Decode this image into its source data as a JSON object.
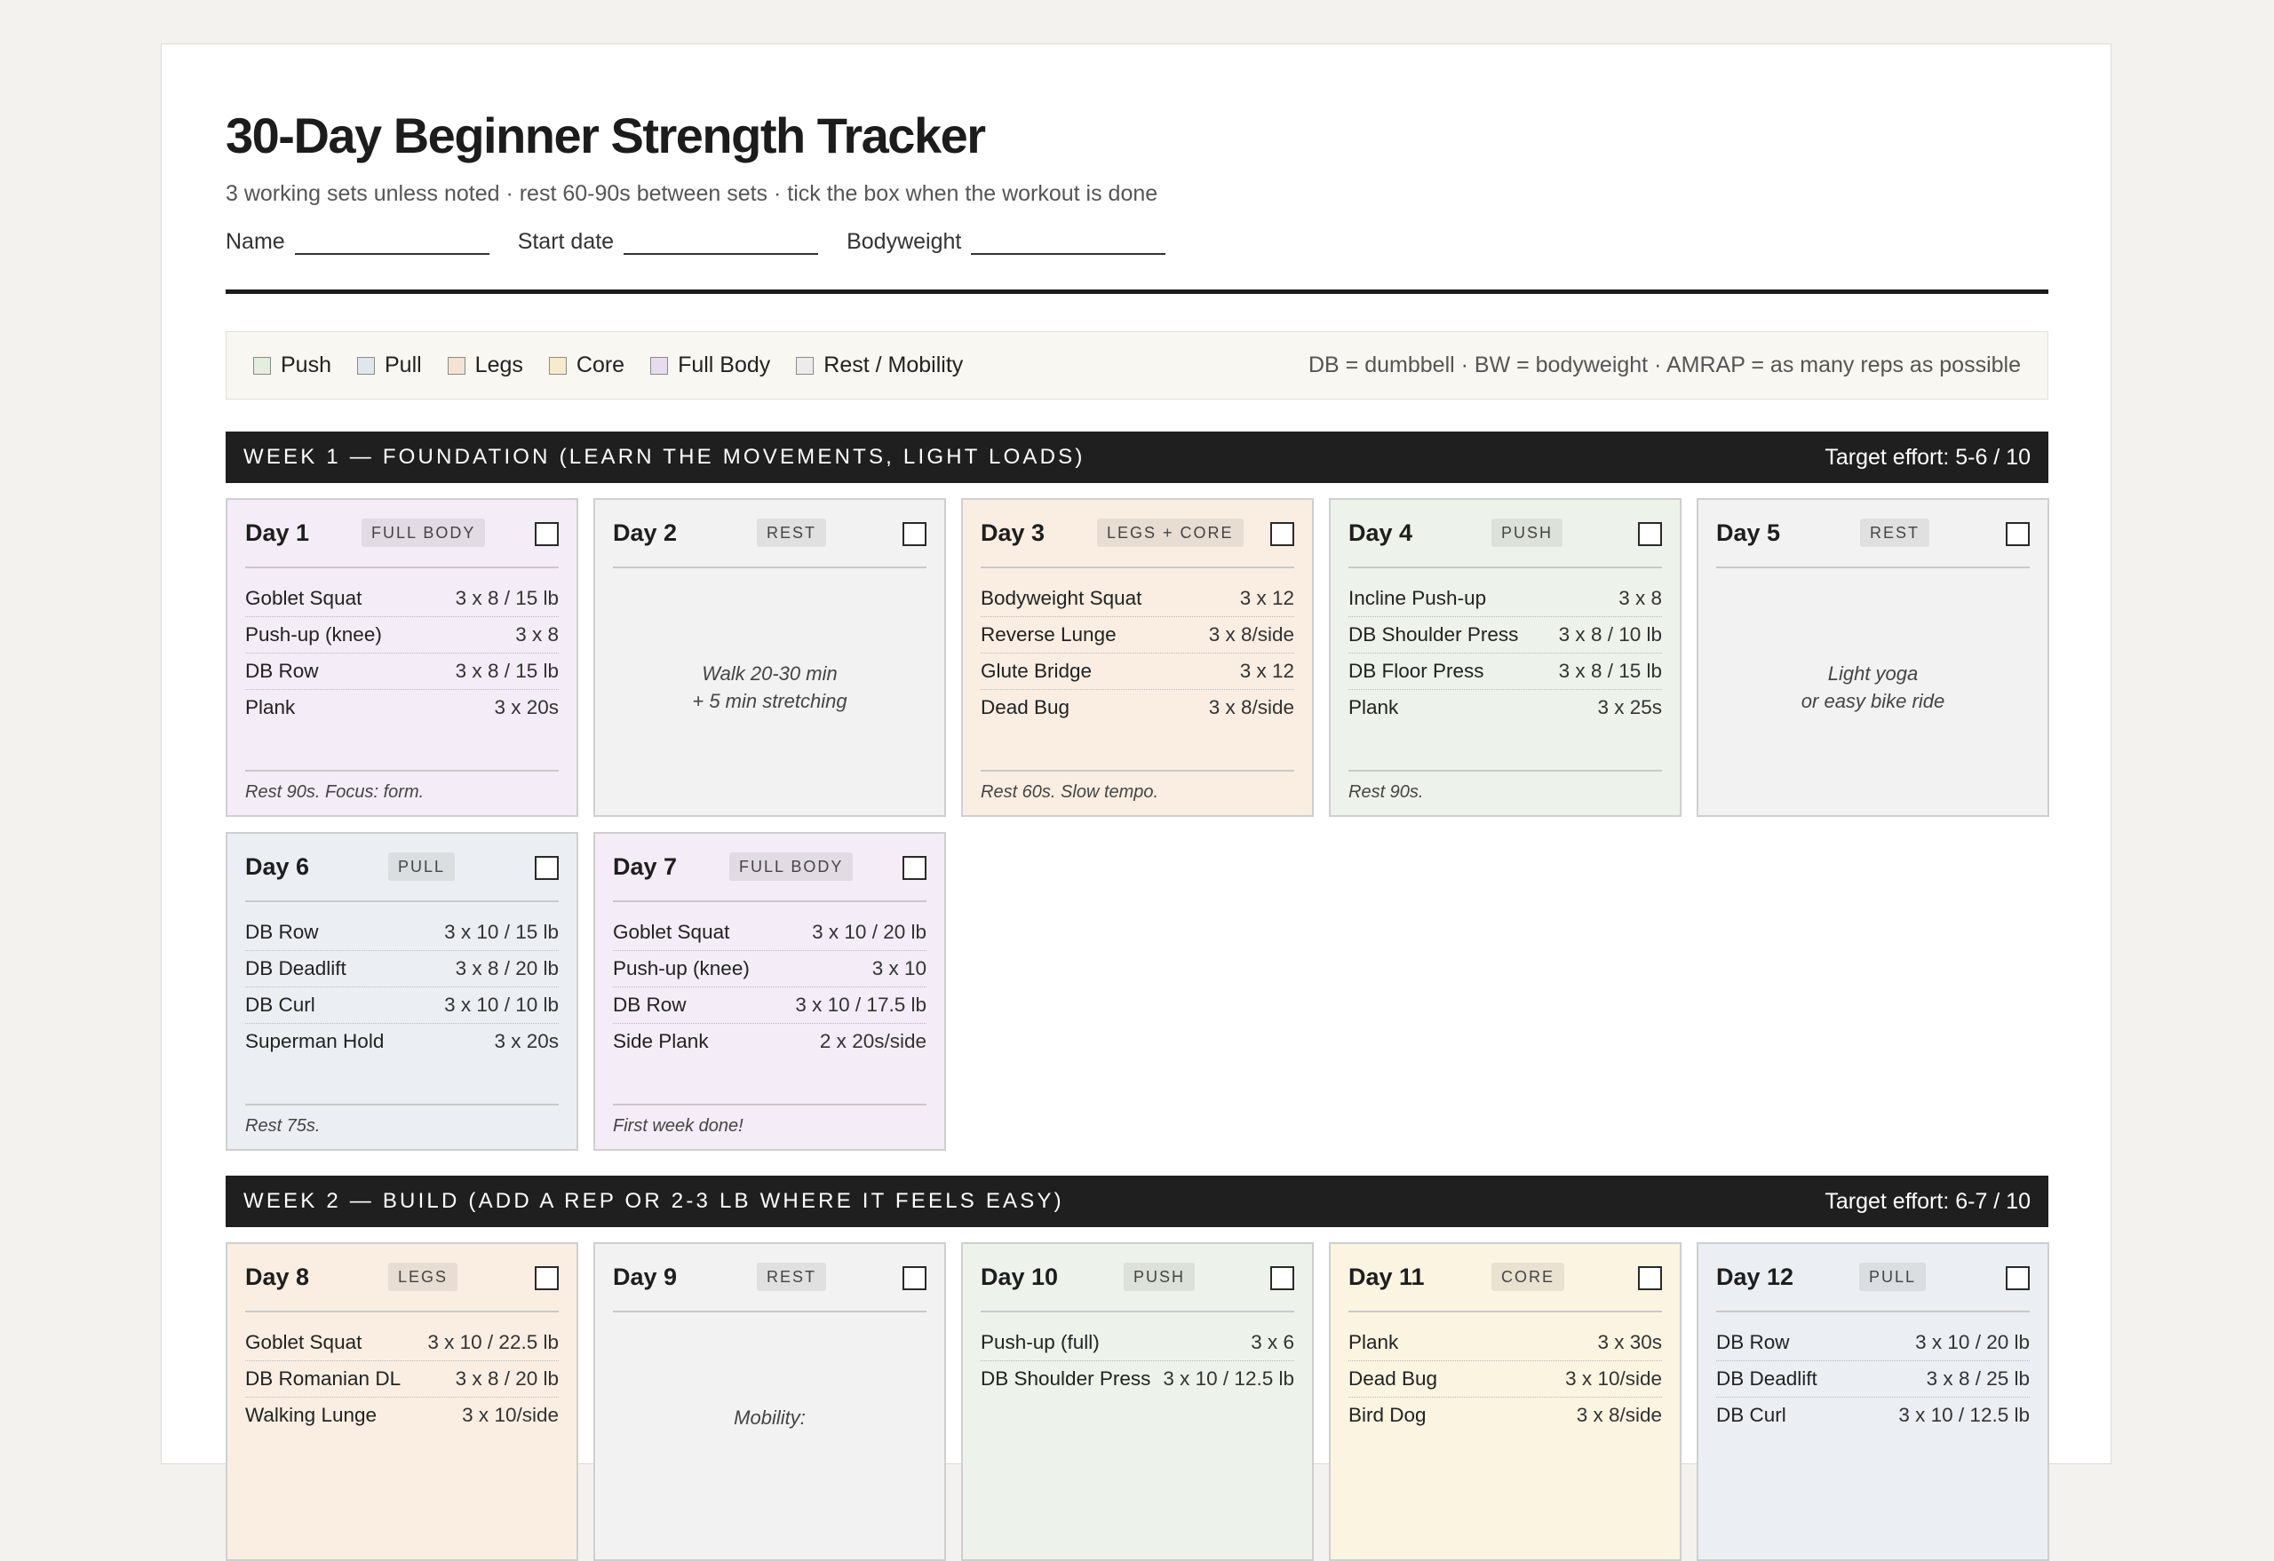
{
  "title": "30-Day Beginner Strength Tracker",
  "subtitle": "3 working sets unless noted · rest 60-90s between sets · tick the box when the workout is done",
  "fields": [
    {
      "label": "Name"
    },
    {
      "label": "Start date"
    },
    {
      "label": "Bodyweight"
    }
  ],
  "legend": {
    "items": [
      {
        "label": "Push",
        "color": "#e4eddf"
      },
      {
        "label": "Pull",
        "color": "#dfe6ee"
      },
      {
        "label": "Legs",
        "color": "#f5e2d2"
      },
      {
        "label": "Core",
        "color": "#f7ebcc"
      },
      {
        "label": "Full Body",
        "color": "#e6dcee"
      },
      {
        "label": "Rest / Mobility",
        "color": "#ececec"
      }
    ],
    "abbreviations": "DB = dumbbell · BW = bodyweight · AMRAP = as many reps as possible"
  },
  "weeks": [
    {
      "title": "WEEK 1 — FOUNDATION (LEARN THE MOVEMENTS, LIGHT LOADS)",
      "target": "Target effort: 5-6 / 10",
      "days": [
        {
          "label": "Day 1",
          "tag": "FULL BODY",
          "type": "fullbody",
          "exercises": [
            {
              "name": "Goblet Squat",
              "scheme": "3 x 8 / 15 lb"
            },
            {
              "name": "Push-up (knee)",
              "scheme": "3 x 8"
            },
            {
              "name": "DB Row",
              "scheme": "3 x 8 / 15 lb"
            },
            {
              "name": "Plank",
              "scheme": "3 x 20s"
            }
          ],
          "note": "Rest 90s. Focus: form."
        },
        {
          "label": "Day 2",
          "tag": "REST",
          "type": "rest",
          "rest_lines": [
            "Walk 20-30 min",
            "+ 5 min stretching"
          ]
        },
        {
          "label": "Day 3",
          "tag": "LEGS + CORE",
          "type": "legs",
          "exercises": [
            {
              "name": "Bodyweight Squat",
              "scheme": "3 x 12"
            },
            {
              "name": "Reverse Lunge",
              "scheme": "3 x 8/side"
            },
            {
              "name": "Glute Bridge",
              "scheme": "3 x 12"
            },
            {
              "name": "Dead Bug",
              "scheme": "3 x 8/side"
            }
          ],
          "note": "Rest 60s. Slow tempo."
        },
        {
          "label": "Day 4",
          "tag": "PUSH",
          "type": "push",
          "exercises": [
            {
              "name": "Incline Push-up",
              "scheme": "3 x 8"
            },
            {
              "name": "DB Shoulder Press",
              "scheme": "3 x 8 / 10 lb"
            },
            {
              "name": "DB Floor Press",
              "scheme": "3 x 8 / 15 lb"
            },
            {
              "name": "Plank",
              "scheme": "3 x 25s"
            }
          ],
          "note": "Rest 90s."
        },
        {
          "label": "Day 5",
          "tag": "REST",
          "type": "rest",
          "rest_lines": [
            "Light yoga",
            "or easy bike ride"
          ]
        },
        {
          "label": "Day 6",
          "tag": "PULL",
          "type": "pull",
          "exercises": [
            {
              "name": "DB Row",
              "scheme": "3 x 10 / 15 lb"
            },
            {
              "name": "DB Deadlift",
              "scheme": "3 x 8 / 20 lb"
            },
            {
              "name": "DB Curl",
              "scheme": "3 x 10 / 10 lb"
            },
            {
              "name": "Superman Hold",
              "scheme": "3 x 20s"
            }
          ],
          "note": "Rest 75s."
        },
        {
          "label": "Day 7",
          "tag": "FULL BODY",
          "type": "fullbody",
          "exercises": [
            {
              "name": "Goblet Squat",
              "scheme": "3 x 10 / 20 lb"
            },
            {
              "name": "Push-up (knee)",
              "scheme": "3 x 10"
            },
            {
              "name": "DB Row",
              "scheme": "3 x 10 / 17.5 lb"
            },
            {
              "name": "Side Plank",
              "scheme": "2 x 20s/side"
            }
          ],
          "note": "First week done!"
        }
      ]
    },
    {
      "title": "WEEK 2 — BUILD (ADD A REP OR 2-3 LB WHERE IT FEELS EASY)",
      "target": "Target effort: 6-7 / 10",
      "days": [
        {
          "label": "Day 8",
          "tag": "LEGS",
          "type": "legs",
          "exercises": [
            {
              "name": "Goblet Squat",
              "scheme": "3 x 10 / 22.5 lb"
            },
            {
              "name": "DB Romanian DL",
              "scheme": "3 x 8 / 20 lb"
            },
            {
              "name": "Walking Lunge",
              "scheme": "3 x 10/side"
            }
          ]
        },
        {
          "label": "Day 9",
          "tag": "REST",
          "type": "rest",
          "rest_lines": [
            "Mobility:"
          ]
        },
        {
          "label": "Day 10",
          "tag": "PUSH",
          "type": "push",
          "exercises": [
            {
              "name": "Push-up (full)",
              "scheme": "3 x 6"
            },
            {
              "name": "DB Shoulder Press",
              "scheme": "3 x 10 / 12.5 lb"
            }
          ]
        },
        {
          "label": "Day 11",
          "tag": "CORE",
          "type": "core",
          "exercises": [
            {
              "name": "Plank",
              "scheme": "3 x 30s"
            },
            {
              "name": "Dead Bug",
              "scheme": "3 x 10/side"
            },
            {
              "name": "Bird Dog",
              "scheme": "3 x 8/side"
            }
          ]
        },
        {
          "label": "Day 12",
          "tag": "PULL",
          "type": "pull",
          "exercises": [
            {
              "name": "DB Row",
              "scheme": "3 x 10 / 20 lb"
            },
            {
              "name": "DB Deadlift",
              "scheme": "3 x 8 / 25 lb"
            },
            {
              "name": "DB Curl",
              "scheme": "3 x 10 / 12.5 lb"
            }
          ]
        }
      ]
    }
  ]
}
